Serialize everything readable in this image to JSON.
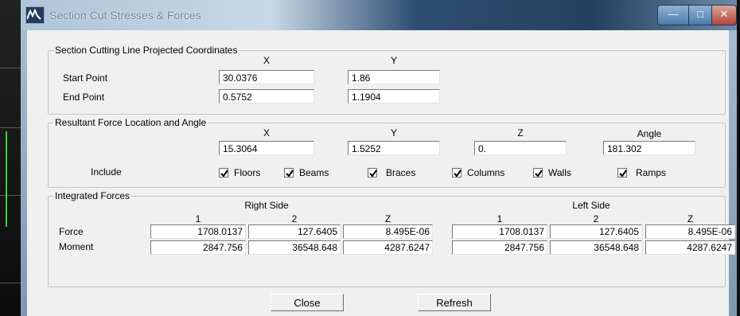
{
  "window": {
    "title": "Section Cut Stresses & Forces",
    "minimize": "—",
    "maximize": "□",
    "close": "✕"
  },
  "section_line": {
    "legend": "Section Cutting Line Projected Coordinates",
    "col_x": "X",
    "col_y": "Y",
    "start_label": "Start Point",
    "start_x": "30.0376",
    "start_y": "1.86",
    "end_label": "End Point",
    "end_x": "0.5752",
    "end_y": "1.1904"
  },
  "resultant": {
    "legend": "Resultant Force Location and Angle",
    "col_x": "X",
    "col_y": "Y",
    "col_z": "Z",
    "col_angle": "Angle",
    "x": "15.3064",
    "y": "1.5252",
    "z": "0.",
    "angle": "181.302",
    "include_label": "Include",
    "checkboxes": [
      {
        "label": "Floors",
        "checked": true
      },
      {
        "label": "Beams",
        "checked": true
      },
      {
        "label": "Braces",
        "checked": true
      },
      {
        "label": "Columns",
        "checked": true
      },
      {
        "label": "Walls",
        "checked": true
      },
      {
        "label": "Ramps",
        "checked": true
      }
    ]
  },
  "integrated": {
    "legend": "Integrated Forces",
    "right_side": "Right Side",
    "left_side": "Left Side",
    "cols": [
      "1",
      "2",
      "Z"
    ],
    "force_label": "Force",
    "moment_label": "Moment",
    "right_force": [
      "1708.0137",
      "127.6405",
      "8.495E-06"
    ],
    "right_moment": [
      "2847.756",
      "36548.648",
      "4287.6247"
    ],
    "left_force": [
      "1708.0137",
      "127.6405",
      "8.495E-06"
    ],
    "left_moment": [
      "2847.756",
      "36548.648",
      "4287.6247"
    ]
  },
  "buttons": {
    "close": "Close",
    "refresh": "Refresh"
  }
}
